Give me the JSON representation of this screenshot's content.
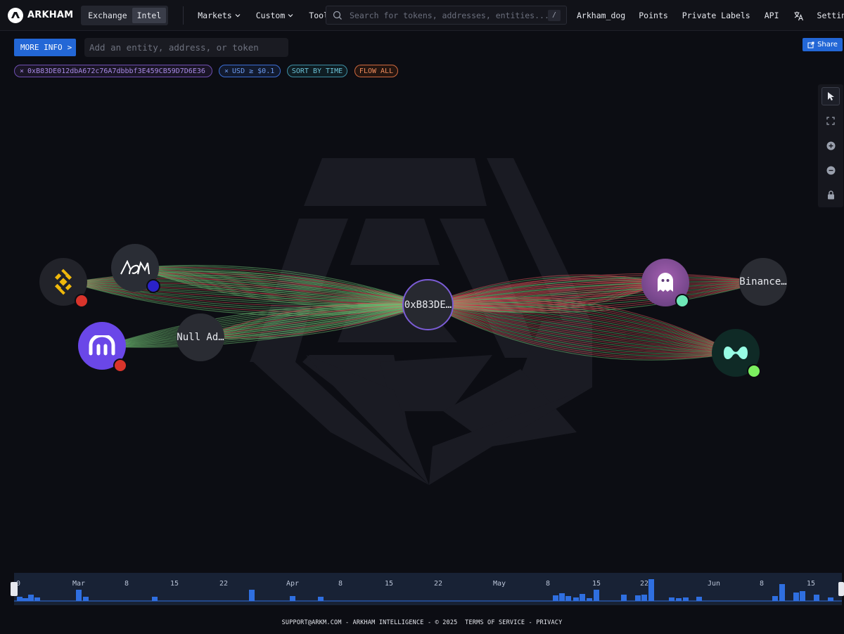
{
  "brand": {
    "name": "ARKHAM"
  },
  "mode_toggle": {
    "exchange": "Exchange",
    "intel": "Intel",
    "active": "intel"
  },
  "nav": {
    "markets": "Markets",
    "custom": "Custom",
    "tools": "Tools"
  },
  "search": {
    "placeholder": "Search for tokens, addresses, entities...",
    "shortcut": "/"
  },
  "right_nav": {
    "user": "Arkham_dog",
    "points": "Points",
    "private_labels": "Private Labels",
    "api": "API",
    "translate_icon": "translate-icon",
    "settings": "Settings"
  },
  "toolbar": {
    "more_info": "MORE INFO",
    "more_info_arrow": ">",
    "add_entity_placeholder": "Add an entity, address, or token",
    "share": "Share"
  },
  "filters": {
    "address": "0xB83DE012dbA672c76A7dbbbf3E459CB59D7D6E36",
    "usd": "USD ≥ $0.1",
    "sort": "SORT BY TIME",
    "flow": "FLOW ALL",
    "remove_symbol": "×"
  },
  "graph": {
    "center_node": {
      "label": "0xB83DE…",
      "color": "#7b5cd6"
    },
    "nodes": [
      {
        "id": "binance-logo",
        "label": "",
        "badge_color": "#d9342b"
      },
      {
        "id": "acm",
        "label": "",
        "badge_color": "#2a22c9"
      },
      {
        "id": "kraken",
        "label": "",
        "badge_color": "#d9342b"
      },
      {
        "id": "null-address",
        "label": "Null Ad…"
      },
      {
        "id": "ghost",
        "label": "",
        "badge_color": "#6ee7b7"
      },
      {
        "id": "binance-address",
        "label": "Binance…"
      },
      {
        "id": "hyperliquid",
        "label": "",
        "badge_color": "#7bf05f"
      }
    ],
    "colors": {
      "inflow": "#6fbf73",
      "outflow": "#d9545a"
    }
  },
  "graph_tools": {
    "items": [
      "cursor-icon",
      "fit-screen-icon",
      "zoom-in-icon",
      "zoom-out-icon",
      "lock-icon"
    ]
  },
  "timeline": {
    "labels": [
      "0",
      "Mar",
      "8",
      "15",
      "22",
      "Apr",
      "8",
      "15",
      "22",
      "May",
      "8",
      "15",
      "22",
      "Jun",
      "8",
      "15"
    ],
    "bar_color": "#2f6fe0"
  },
  "footer": {
    "text": "SUPPORT@ARKM.COM - ARKHAM INTELLIGENCE - © 2025",
    "terms": "TERMS OF SERVICE",
    "sep": "-",
    "privacy": "PRIVACY"
  }
}
